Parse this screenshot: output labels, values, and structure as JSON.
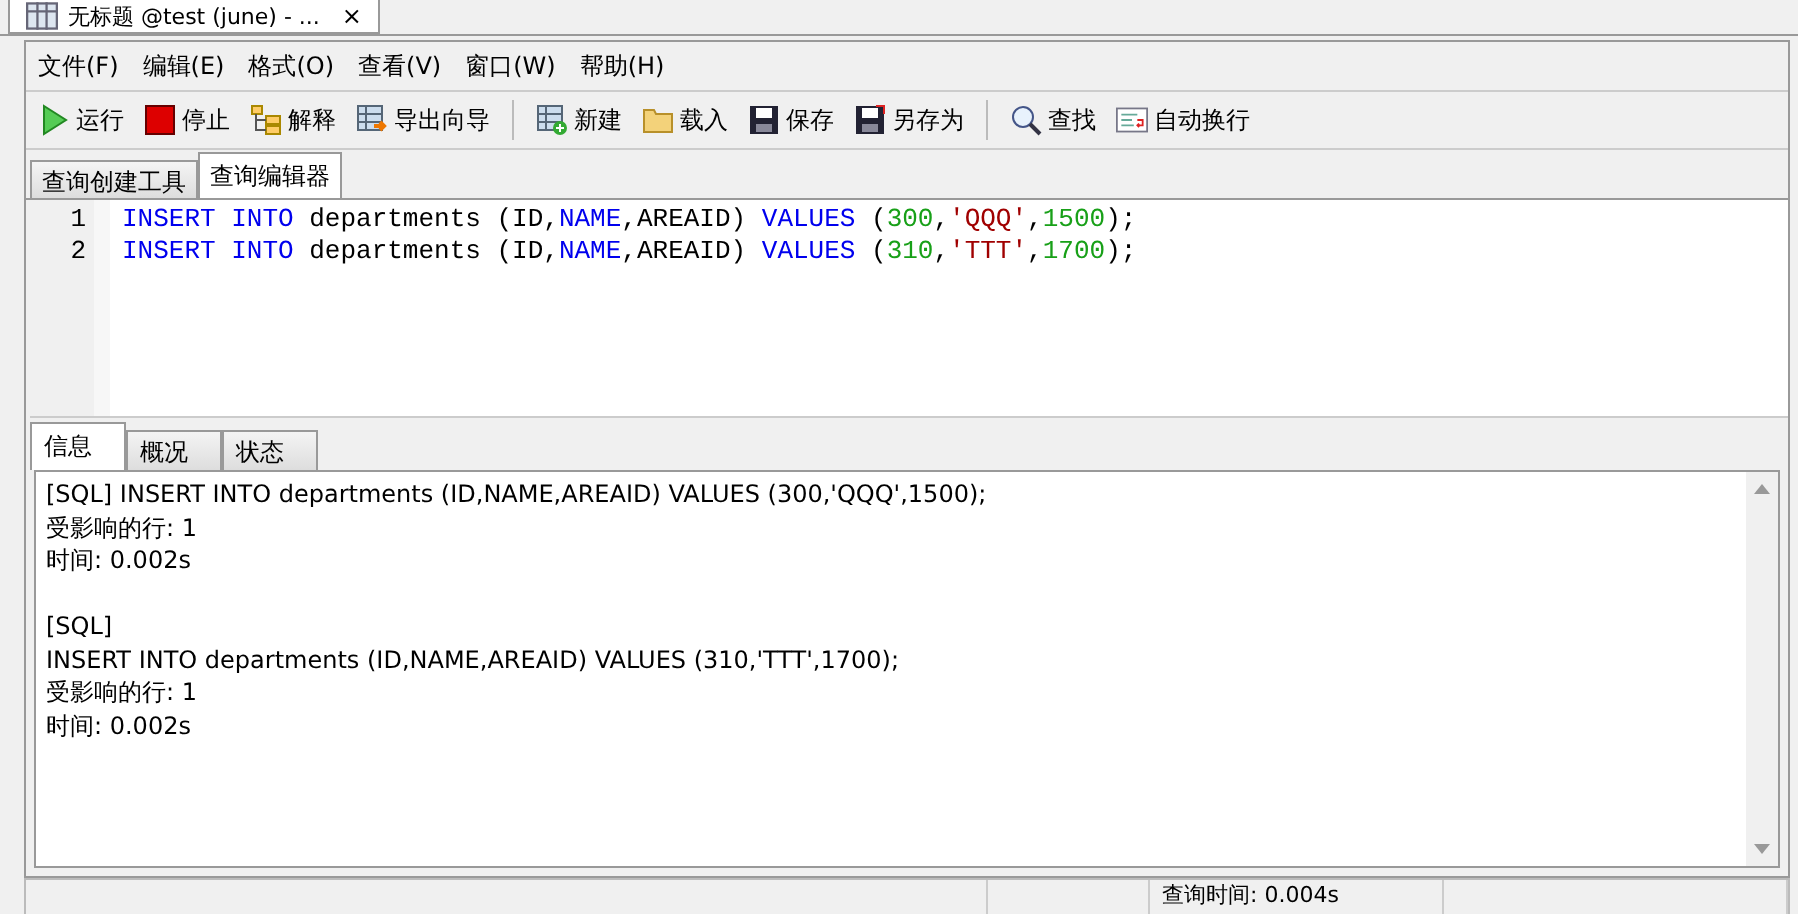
{
  "window": {
    "title": "无标题 @test (june) - ...",
    "close": "×"
  },
  "menu": [
    "文件(F)",
    "编辑(E)",
    "格式(O)",
    "查看(V)",
    "窗口(W)",
    "帮助(H)"
  ],
  "toolbar": [
    {
      "kind": "run",
      "label": "运行"
    },
    {
      "kind": "stop",
      "label": "停止"
    },
    {
      "kind": "explain",
      "label": "解释"
    },
    {
      "kind": "export",
      "label": "导出向导"
    },
    {
      "kind": "sep"
    },
    {
      "kind": "new",
      "label": "新建"
    },
    {
      "kind": "load",
      "label": "载入"
    },
    {
      "kind": "save",
      "label": "保存"
    },
    {
      "kind": "saveas",
      "label": "另存为"
    },
    {
      "kind": "sep"
    },
    {
      "kind": "find",
      "label": "查找"
    },
    {
      "kind": "wrap",
      "label": "自动换行"
    }
  ],
  "tabs": [
    {
      "label": "查询创建工具",
      "selected": false
    },
    {
      "label": "查询编辑器",
      "selected": true
    }
  ],
  "editor": {
    "lines": [
      {
        "number": "1",
        "tokens": [
          {
            "kind": "keyword",
            "text": "INSERT INTO"
          },
          {
            "kind": "plain",
            "text": " departments (ID,"
          },
          {
            "kind": "keyword",
            "text": "NAME"
          },
          {
            "kind": "plain",
            "text": ",AREAID) "
          },
          {
            "kind": "keyword",
            "text": "VALUES"
          },
          {
            "kind": "plain",
            "text": " ("
          },
          {
            "kind": "number",
            "text": "300"
          },
          {
            "kind": "plain",
            "text": ","
          },
          {
            "kind": "string",
            "text": "'QQQ'"
          },
          {
            "kind": "plain",
            "text": ","
          },
          {
            "kind": "number",
            "text": "1500"
          },
          {
            "kind": "plain",
            "text": ");"
          }
        ]
      },
      {
        "number": "2",
        "tokens": [
          {
            "kind": "keyword",
            "text": "INSERT INTO"
          },
          {
            "kind": "plain",
            "text": " departments (ID,"
          },
          {
            "kind": "keyword",
            "text": "NAME"
          },
          {
            "kind": "plain",
            "text": ",AREAID) "
          },
          {
            "kind": "keyword",
            "text": "VALUES"
          },
          {
            "kind": "plain",
            "text": " ("
          },
          {
            "kind": "number",
            "text": "310"
          },
          {
            "kind": "plain",
            "text": ","
          },
          {
            "kind": "string",
            "text": "'TTT'"
          },
          {
            "kind": "plain",
            "text": ","
          },
          {
            "kind": "number",
            "text": "1700"
          },
          {
            "kind": "plain",
            "text": ");"
          }
        ]
      }
    ]
  },
  "result_tabs": [
    {
      "label": "信息",
      "selected": true
    },
    {
      "label": "概况",
      "selected": false
    },
    {
      "label": "状态",
      "selected": false
    }
  ],
  "messages": [
    [
      "[SQL] INSERT INTO departments (ID,NAME,AREAID) VALUES (300,'QQQ',1500);",
      "受影响的行: 1",
      "时间: 0.002s"
    ],
    [
      "[SQL]",
      "INSERT INTO departments (ID,NAME,AREAID) VALUES (310,'TTT',1700);",
      "受影响的行: 1",
      "时间: 0.002s"
    ]
  ],
  "status_bar": {
    "query_time": "查询时间: 0.004s"
  }
}
